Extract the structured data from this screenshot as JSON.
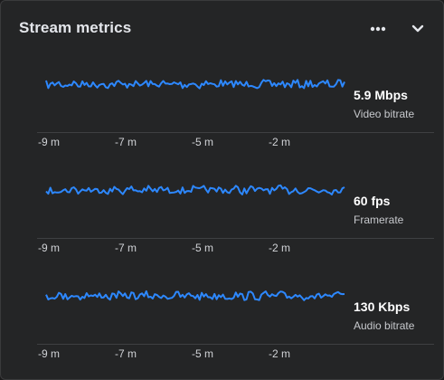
{
  "header": {
    "title": "Stream metrics",
    "more_icon": "more-horizontal-icon",
    "collapse_icon": "chevron-down-icon"
  },
  "accent_color": "#2d88ff",
  "metrics": [
    {
      "value": "5.9 Mbps",
      "label": "Video bitrate",
      "x_ticks": [
        "-9 m",
        "-7 m",
        "-5 m",
        "-2 m"
      ]
    },
    {
      "value": "60 fps",
      "label": "Framerate",
      "x_ticks": [
        "-9 m",
        "-7 m",
        "-5 m",
        "-2 m"
      ]
    },
    {
      "value": "130 Kbps",
      "label": "Audio bitrate",
      "x_ticks": [
        "-9 m",
        "-7 m",
        "-5 m",
        "-2 m"
      ]
    }
  ]
}
